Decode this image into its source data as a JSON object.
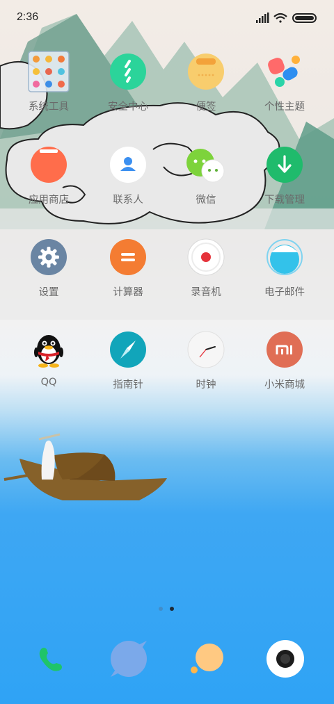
{
  "status_bar": {
    "time": "2:36",
    "icons": [
      "signal-icon",
      "wifi-icon",
      "battery-icon"
    ]
  },
  "home_rows": [
    [
      {
        "label": "系统工具",
        "icon": "folder-icon"
      },
      {
        "label": "安全中心",
        "icon": "security-center-icon"
      },
      {
        "label": "便签",
        "icon": "notes-icon"
      },
      {
        "label": "个性主题",
        "icon": "themes-icon"
      }
    ],
    [
      {
        "label": "应用商店",
        "icon": "app-store-icon"
      },
      {
        "label": "联系人",
        "icon": "contacts-icon"
      },
      {
        "label": "微信",
        "icon": "wechat-icon"
      },
      {
        "label": "下载管理",
        "icon": "download-icon"
      }
    ],
    [
      {
        "label": "设置",
        "icon": "settings-gear-icon"
      },
      {
        "label": "计算器",
        "icon": "calculator-icon"
      },
      {
        "label": "录音机",
        "icon": "recorder-icon"
      },
      {
        "label": "电子邮件",
        "icon": "email-icon"
      }
    ],
    [
      {
        "label": "QQ",
        "icon": "qq-penguin-icon"
      },
      {
        "label": "指南针",
        "icon": "compass-icon"
      },
      {
        "label": "时钟",
        "icon": "clock-icon"
      },
      {
        "label": "小米商城",
        "icon": "mi-store-icon"
      }
    ]
  ],
  "page_indicator": {
    "pages": 2,
    "current": 2
  },
  "dock": [
    {
      "name": "phone",
      "icon": "phone-icon"
    },
    {
      "name": "messages",
      "icon": "messages-icon"
    },
    {
      "name": "browser",
      "icon": "browser-icon"
    },
    {
      "name": "camera",
      "icon": "camera-icon"
    }
  ],
  "colors": {
    "sky_blue": "#2fa3f5",
    "security_green": "#2bd49a",
    "notes_yellow": "#f8cd6d",
    "store_orange": "#ff6d4b",
    "contacts_blue": "#3b8ff0",
    "wechat_green": "#7dd33b",
    "download_green": "#1fbb6c",
    "settings_slate": "#6a85a3",
    "calc_orange": "#f47c32",
    "compass_teal": "#11a5ba",
    "mi_orange": "#e06e55"
  }
}
